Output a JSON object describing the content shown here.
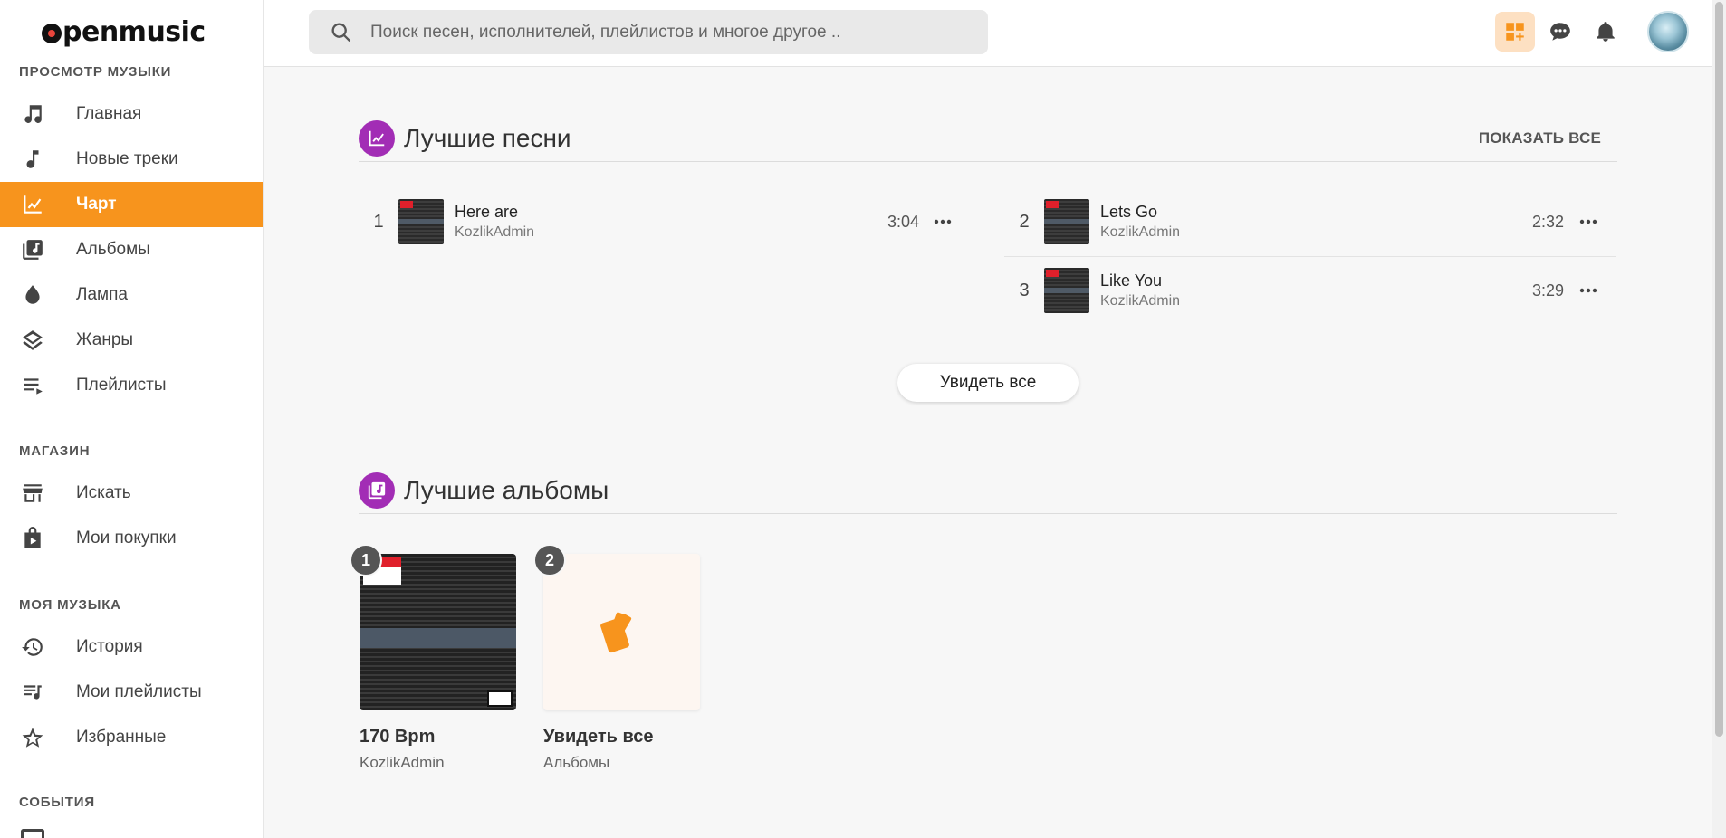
{
  "app": {
    "logo": "penmusic"
  },
  "search": {
    "placeholder": "Поиск песен, исполнителей, плейлистов и многое другое .."
  },
  "sidebar": {
    "sections": [
      {
        "title": "ПРОСМОТР МУЗЫКИ"
      },
      {
        "title": "МАГАЗИН"
      },
      {
        "title": "МОЯ МУЗЫКА"
      },
      {
        "title": "СОБЫТИЯ"
      }
    ],
    "items": [
      {
        "label": "Главная",
        "icon": "music-note-icon"
      },
      {
        "label": "Новые треки",
        "icon": "single-note-icon"
      },
      {
        "label": "Чарт",
        "icon": "chart-icon",
        "active": true
      },
      {
        "label": "Альбомы",
        "icon": "album-icon"
      },
      {
        "label": "Лампа",
        "icon": "drop-icon"
      },
      {
        "label": "Жанры",
        "icon": "layers-icon"
      },
      {
        "label": "Плейлисты",
        "icon": "playlist-icon"
      },
      {
        "label": "Искать",
        "icon": "store-icon"
      },
      {
        "label": "Мои покупки",
        "icon": "purchases-icon"
      },
      {
        "label": "История",
        "icon": "history-icon"
      },
      {
        "label": "Мои плейлисты",
        "icon": "my-playlists-icon"
      },
      {
        "label": "Избранные",
        "icon": "star-icon"
      }
    ]
  },
  "top_songs": {
    "title": "Лучшие песни",
    "show_all": "ПОКАЗАТЬ ВСЕ",
    "see_all_button": "Увидеть все",
    "tracks": [
      {
        "rank": "1",
        "title": "Here are",
        "artist": "KozlikAdmin",
        "duration": "3:04"
      },
      {
        "rank": "2",
        "title": "Lets Go",
        "artist": "KozlikAdmin",
        "duration": "2:32"
      },
      {
        "rank": "3",
        "title": "Like You",
        "artist": "KozlikAdmin",
        "duration": "3:29"
      }
    ]
  },
  "top_albums": {
    "title": "Лучшие альбомы",
    "albums": [
      {
        "rank": "1",
        "title": "170 Bpm",
        "subtitle": "KozlikAdmin"
      },
      {
        "rank": "2",
        "title": "Увидеть все",
        "subtitle": "Альбомы"
      }
    ]
  },
  "colors": {
    "accent": "#f7941d",
    "section_badge": "#a22db5"
  }
}
